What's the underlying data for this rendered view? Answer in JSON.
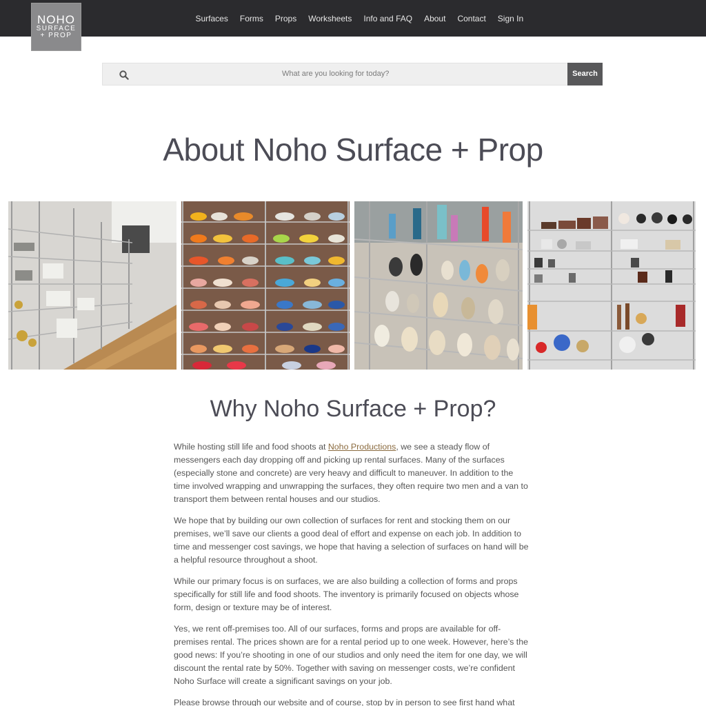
{
  "logo": {
    "line1": "NOHO",
    "line2": "SURFACE",
    "line3": "+ PROP"
  },
  "nav": {
    "items": [
      "Surfaces",
      "Forms",
      "Props",
      "Worksheets",
      "Info and FAQ",
      "About",
      "Contact",
      "Sign In"
    ]
  },
  "search": {
    "placeholder": "What are you looking for today?",
    "button_label": "Search"
  },
  "page_title": "About Noho Surface + Prop",
  "photos": [
    {
      "icon": "warehouse-shelves-photo"
    },
    {
      "icon": "colorful-dishes-photo"
    },
    {
      "icon": "ceramic-vases-photo"
    },
    {
      "icon": "props-collection-photo"
    }
  ],
  "section_title": "Why Noho Surface + Prop?",
  "paragraphs": {
    "p1_before": "While hosting still life and food shoots at ",
    "p1_link": "Noho Productions",
    "p1_after": ", we see a steady flow of messengers each day dropping off and picking up rental surfaces. Many of the surfaces (especially stone and concrete) are very heavy and difficult to maneuver. In addition to the time involved wrapping and unwrapping the surfaces, they often require two men and a van to transport them between rental houses and our studios.",
    "p2": "We hope that by building our own collection of surfaces for rent and stocking them on our premises, we’ll save our clients a good deal of effort and expense on each job. In addition to time and messenger cost savings, we hope that having a selection of surfaces on hand will be a helpful resource throughout a shoot.",
    "p3": "While our primary focus is on surfaces, we are also building a collection of forms and props specifically for still life and food shoots. The inventory is primarily focused on objects whose form, design or texture may be of interest.",
    "p4": "Yes, we rent off-premises too. All of our surfaces, forms and props are available for off-premises rental. The prices shown are for a rental period up to one week. However, here’s the good news: If you’re shooting in one of our studios and only need the item for one day, we will discount the rental rate by 50%. Together with saving on messenger costs, we’re confident Noho Surface will create a significant savings on your job.",
    "p5": "Please browse through our website and of course, stop by in person to see first hand what"
  },
  "colors": {
    "topbar": "#2b2b2e",
    "logo_bg": "#8a8a8c",
    "search_button": "#58585a",
    "link": "#8a6a3e"
  }
}
